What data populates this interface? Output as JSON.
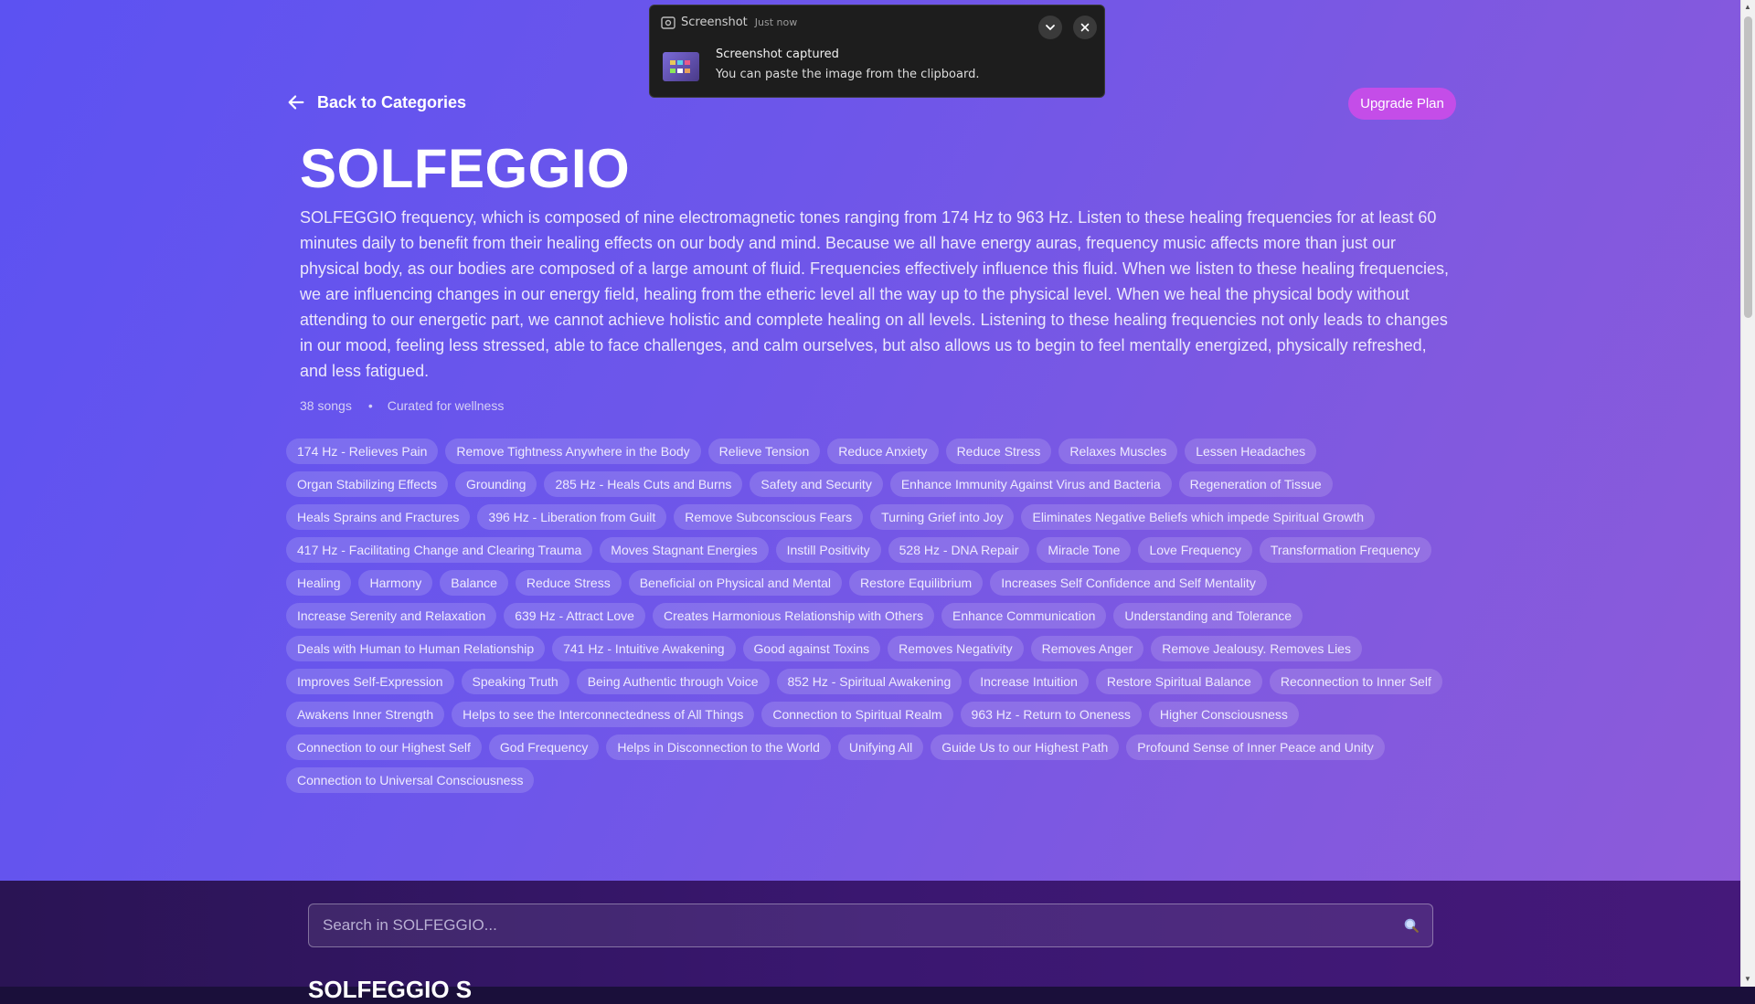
{
  "nav": {
    "back_label": "Back to Categories",
    "upgrade_label": "Upgrade Plan"
  },
  "category": {
    "title": "SOLFEGGIO",
    "description": "SOLFEGGIO frequency, which is composed of nine electromagnetic tones ranging from 174 Hz to 963 Hz. Listen to these healing frequencies for at least 60 minutes daily to benefit from their healing effects on our body and mind. Because we all have energy auras, frequency music affects more than just our physical body, as our bodies are composed of a large amount of fluid. Frequencies effectively influence this fluid. When we listen to these healing frequencies, we are influencing changes in our energy field, healing from the etheric level all the way up to the physical level. When we heal the physical body without attending to our energetic part, we cannot achieve holistic and complete healing on all levels. Listening to these healing frequencies not only leads to changes in our mood, feeling less stressed, able to face challenges, and calm ourselves, but also allows us to begin to feel mentally energized, physically refreshed, and less fatigued.",
    "song_count": "38 songs",
    "curated": "Curated for wellness"
  },
  "tags": [
    "174 Hz - Relieves Pain",
    "Remove Tightness Anywhere in the Body",
    "Relieve Tension",
    "Reduce Anxiety",
    "Reduce Stress",
    "Relaxes Muscles",
    "Lessen Headaches",
    "Organ Stabilizing Effects",
    "Grounding",
    "285 Hz - Heals Cuts and Burns",
    "Safety and Security",
    "Enhance Immunity Against Virus and Bacteria",
    "Regeneration of Tissue",
    "Heals Sprains and Fractures",
    "396 Hz - Liberation from Guilt",
    "Remove Subconscious Fears",
    "Turning Grief into Joy",
    "Eliminates Negative Beliefs which impede Spiritual Growth",
    "417 Hz - Facilitating Change and Clearing Trauma",
    "Moves Stagnant Energies",
    "Instill Positivity",
    "528 Hz - DNA Repair",
    "Miracle Tone",
    "Love Frequency",
    "Transformation Frequency",
    "Healing",
    "Harmony",
    "Balance",
    "Reduce Stress",
    "Beneficial on Physical and Mental",
    "Restore Equilibrium",
    "Increases Self Confidence and Self Mentality",
    "Increase Serenity and Relaxation",
    "639 Hz - Attract Love",
    "Creates Harmonious Relationship with Others",
    "Enhance Communication",
    "Understanding and Tolerance",
    "Deals with Human to Human Relationship",
    "741 Hz - Intuitive Awakening",
    "Good against Toxins",
    "Removes Negativity",
    "Removes Anger",
    "Remove Jealousy. Removes Lies",
    "Improves Self-Expression",
    "Speaking Truth",
    "Being Authentic through Voice",
    "852 Hz - Spiritual Awakening",
    "Increase Intuition",
    "Restore Spiritual Balance",
    "Reconnection to Inner Self",
    "Awakens Inner Strength",
    "Helps to see the Interconnectedness of All Things",
    "Connection to Spiritual Realm",
    "963 Hz - Return to Oneness",
    "Higher Consciousness",
    "Connection to our Highest Self",
    "God Frequency",
    "Helps in Disconnection to the World",
    "Unifying All",
    "Guide Us to our Highest Path",
    "Profound Sense of Inner Peace and Unity",
    "Connection to Universal Consciousness"
  ],
  "search": {
    "placeholder": "Search in SOLFEGGIO..."
  },
  "section": {
    "heading": "SOLFEGGIO S"
  },
  "toast": {
    "app_name": "Screenshot",
    "time": "Just now",
    "title": "Screenshot captured",
    "body": "You can paste the image from the clipboard."
  }
}
